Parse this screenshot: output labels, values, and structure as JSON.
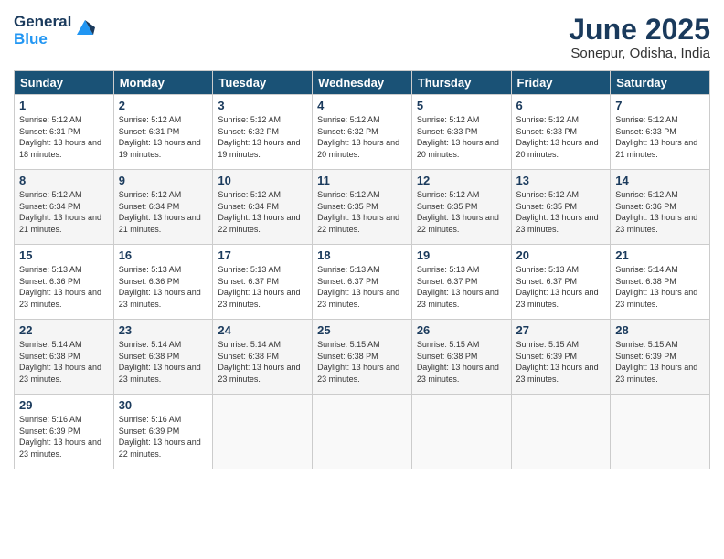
{
  "header": {
    "logo_general": "General",
    "logo_blue": "Blue",
    "title": "June 2025",
    "location": "Sonepur, Odisha, India"
  },
  "weekdays": [
    "Sunday",
    "Monday",
    "Tuesday",
    "Wednesday",
    "Thursday",
    "Friday",
    "Saturday"
  ],
  "weeks": [
    [
      {
        "day": "1",
        "sunrise": "5:12 AM",
        "sunset": "6:31 PM",
        "daylight": "13 hours and 18 minutes."
      },
      {
        "day": "2",
        "sunrise": "5:12 AM",
        "sunset": "6:31 PM",
        "daylight": "13 hours and 19 minutes."
      },
      {
        "day": "3",
        "sunrise": "5:12 AM",
        "sunset": "6:32 PM",
        "daylight": "13 hours and 19 minutes."
      },
      {
        "day": "4",
        "sunrise": "5:12 AM",
        "sunset": "6:32 PM",
        "daylight": "13 hours and 20 minutes."
      },
      {
        "day": "5",
        "sunrise": "5:12 AM",
        "sunset": "6:33 PM",
        "daylight": "13 hours and 20 minutes."
      },
      {
        "day": "6",
        "sunrise": "5:12 AM",
        "sunset": "6:33 PM",
        "daylight": "13 hours and 20 minutes."
      },
      {
        "day": "7",
        "sunrise": "5:12 AM",
        "sunset": "6:33 PM",
        "daylight": "13 hours and 21 minutes."
      }
    ],
    [
      {
        "day": "8",
        "sunrise": "5:12 AM",
        "sunset": "6:34 PM",
        "daylight": "13 hours and 21 minutes."
      },
      {
        "day": "9",
        "sunrise": "5:12 AM",
        "sunset": "6:34 PM",
        "daylight": "13 hours and 21 minutes."
      },
      {
        "day": "10",
        "sunrise": "5:12 AM",
        "sunset": "6:34 PM",
        "daylight": "13 hours and 22 minutes."
      },
      {
        "day": "11",
        "sunrise": "5:12 AM",
        "sunset": "6:35 PM",
        "daylight": "13 hours and 22 minutes."
      },
      {
        "day": "12",
        "sunrise": "5:12 AM",
        "sunset": "6:35 PM",
        "daylight": "13 hours and 22 minutes."
      },
      {
        "day": "13",
        "sunrise": "5:12 AM",
        "sunset": "6:35 PM",
        "daylight": "13 hours and 23 minutes."
      },
      {
        "day": "14",
        "sunrise": "5:12 AM",
        "sunset": "6:36 PM",
        "daylight": "13 hours and 23 minutes."
      }
    ],
    [
      {
        "day": "15",
        "sunrise": "5:13 AM",
        "sunset": "6:36 PM",
        "daylight": "13 hours and 23 minutes."
      },
      {
        "day": "16",
        "sunrise": "5:13 AM",
        "sunset": "6:36 PM",
        "daylight": "13 hours and 23 minutes."
      },
      {
        "day": "17",
        "sunrise": "5:13 AM",
        "sunset": "6:37 PM",
        "daylight": "13 hours and 23 minutes."
      },
      {
        "day": "18",
        "sunrise": "5:13 AM",
        "sunset": "6:37 PM",
        "daylight": "13 hours and 23 minutes."
      },
      {
        "day": "19",
        "sunrise": "5:13 AM",
        "sunset": "6:37 PM",
        "daylight": "13 hours and 23 minutes."
      },
      {
        "day": "20",
        "sunrise": "5:13 AM",
        "sunset": "6:37 PM",
        "daylight": "13 hours and 23 minutes."
      },
      {
        "day": "21",
        "sunrise": "5:14 AM",
        "sunset": "6:38 PM",
        "daylight": "13 hours and 23 minutes."
      }
    ],
    [
      {
        "day": "22",
        "sunrise": "5:14 AM",
        "sunset": "6:38 PM",
        "daylight": "13 hours and 23 minutes."
      },
      {
        "day": "23",
        "sunrise": "5:14 AM",
        "sunset": "6:38 PM",
        "daylight": "13 hours and 23 minutes."
      },
      {
        "day": "24",
        "sunrise": "5:14 AM",
        "sunset": "6:38 PM",
        "daylight": "13 hours and 23 minutes."
      },
      {
        "day": "25",
        "sunrise": "5:15 AM",
        "sunset": "6:38 PM",
        "daylight": "13 hours and 23 minutes."
      },
      {
        "day": "26",
        "sunrise": "5:15 AM",
        "sunset": "6:38 PM",
        "daylight": "13 hours and 23 minutes."
      },
      {
        "day": "27",
        "sunrise": "5:15 AM",
        "sunset": "6:39 PM",
        "daylight": "13 hours and 23 minutes."
      },
      {
        "day": "28",
        "sunrise": "5:15 AM",
        "sunset": "6:39 PM",
        "daylight": "13 hours and 23 minutes."
      }
    ],
    [
      {
        "day": "29",
        "sunrise": "5:16 AM",
        "sunset": "6:39 PM",
        "daylight": "13 hours and 23 minutes."
      },
      {
        "day": "30",
        "sunrise": "5:16 AM",
        "sunset": "6:39 PM",
        "daylight": "13 hours and 22 minutes."
      },
      null,
      null,
      null,
      null,
      null
    ]
  ]
}
